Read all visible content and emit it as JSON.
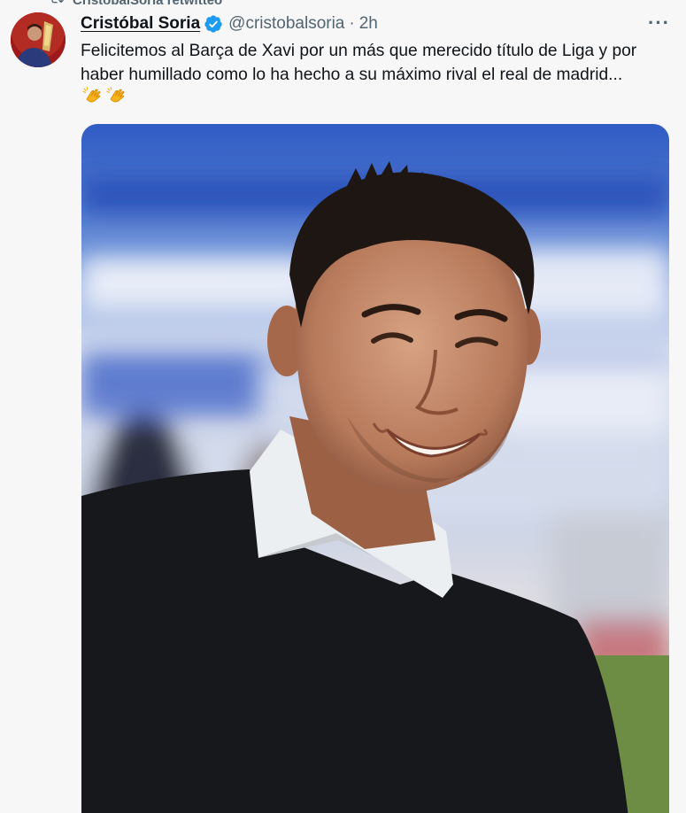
{
  "retweet": {
    "text": "CristobalSoria retwitteó",
    "icon": "retweet-icon"
  },
  "author": {
    "display_name": "Cristóbal Soria",
    "handle": "@cristobalsoria",
    "separator": "·",
    "time": "2h",
    "verified": true,
    "avatar_icon": "avatar-photo"
  },
  "menu": {
    "more_label": "···"
  },
  "tweet": {
    "line1": "Felicitemos al Barça de Xavi por un más que merecido título de Liga y por",
    "line2": "haber humillado como lo ha hecho a su máximo rival el real de madrid...",
    "emojis": [
      "clapping-hands-icon",
      "clapping-hands-icon"
    ]
  },
  "media": {
    "kind": "photo",
    "subject": "smiling man in dark sweater with white collar at a stadium"
  },
  "colors": {
    "background": "#f7f7f8",
    "text": "#0f1419",
    "muted": "#536471",
    "verified": "#1d9bf0"
  }
}
